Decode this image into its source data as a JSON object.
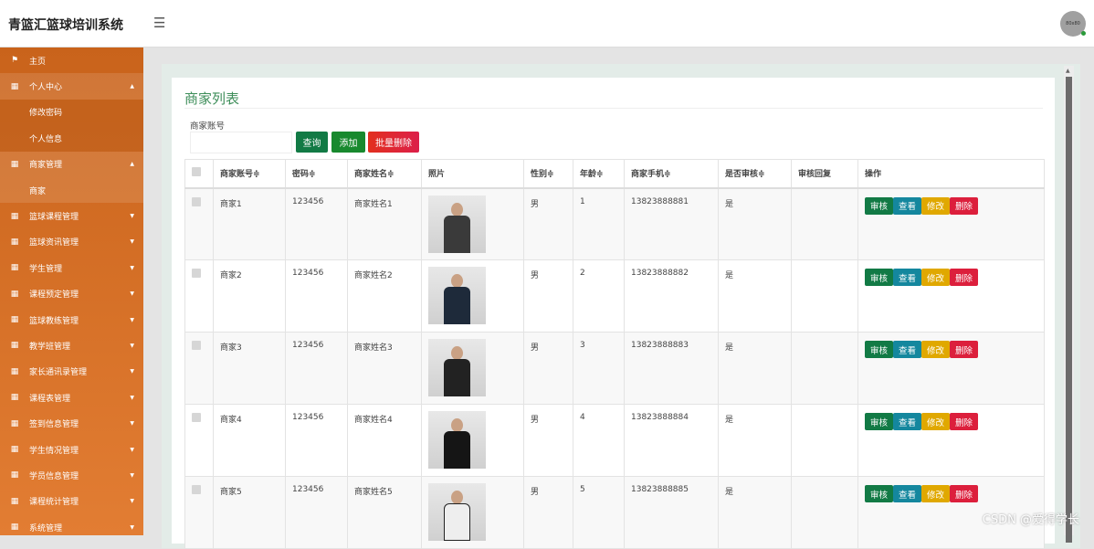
{
  "header": {
    "title": "青篮汇篮球培训系统",
    "avatar": "80x80"
  },
  "sidebar": [
    {
      "label": "主页",
      "icon": "flag-icon",
      "type": "top"
    },
    {
      "label": "个人中心",
      "icon": "grid-icon",
      "type": "open"
    },
    {
      "label": "修改密码",
      "type": "sub"
    },
    {
      "label": "个人信息",
      "type": "sub"
    },
    {
      "label": "商家管理",
      "icon": "grid-icon",
      "type": "open"
    },
    {
      "label": "商家",
      "type": "subactive"
    },
    {
      "label": "篮球课程管理",
      "icon": "grid-icon"
    },
    {
      "label": "篮球资讯管理",
      "icon": "grid-icon"
    },
    {
      "label": "学生管理",
      "icon": "grid-icon"
    },
    {
      "label": "课程预定管理",
      "icon": "grid-icon"
    },
    {
      "label": "篮球教练管理",
      "icon": "grid-icon"
    },
    {
      "label": "教学班管理",
      "icon": "grid-icon"
    },
    {
      "label": "家长通讯录管理",
      "icon": "grid-icon"
    },
    {
      "label": "课程表管理",
      "icon": "grid-icon"
    },
    {
      "label": "签到信息管理",
      "icon": "grid-icon"
    },
    {
      "label": "学生情况管理",
      "icon": "grid-icon"
    },
    {
      "label": "学员信息管理",
      "icon": "grid-icon"
    },
    {
      "label": "课程统计管理",
      "icon": "grid-icon"
    },
    {
      "label": "系统管理",
      "icon": "grid-icon"
    }
  ],
  "main": {
    "title": "商家列表",
    "filter_label": "商家账号",
    "filter_value": "",
    "buttons": {
      "search": "查询",
      "add": "添加",
      "batch_delete": "批量删除"
    },
    "columns": [
      "商家账号≑",
      "密码≑",
      "商家姓名≑",
      "照片",
      "性别≑",
      "年龄≑",
      "商家手机≑",
      "是否审核≑",
      "审核回复",
      "操作"
    ],
    "rows": [
      {
        "account": "商家1",
        "password": "123456",
        "name": "商家姓名1",
        "gender": "男",
        "age": "1",
        "phone": "13823888881",
        "audited": "是",
        "reply": ""
      },
      {
        "account": "商家2",
        "password": "123456",
        "name": "商家姓名2",
        "gender": "男",
        "age": "2",
        "phone": "13823888882",
        "audited": "是",
        "reply": ""
      },
      {
        "account": "商家3",
        "password": "123456",
        "name": "商家姓名3",
        "gender": "男",
        "age": "3",
        "phone": "13823888883",
        "audited": "是",
        "reply": ""
      },
      {
        "account": "商家4",
        "password": "123456",
        "name": "商家姓名4",
        "gender": "男",
        "age": "4",
        "phone": "13823888884",
        "audited": "是",
        "reply": ""
      },
      {
        "account": "商家5",
        "password": "123456",
        "name": "商家姓名5",
        "gender": "男",
        "age": "5",
        "phone": "13823888885",
        "audited": "是",
        "reply": ""
      }
    ],
    "row_actions": [
      "审核",
      "查看",
      "修改",
      "删除"
    ]
  },
  "colors": {
    "accent": "#3e8e5a",
    "audit": "#127a45",
    "view": "#14879e",
    "edit": "#e0a800",
    "delete": "#dc1f3c",
    "add": "#18892e",
    "sidebar": "#d5701f"
  },
  "watermark": "CSDN @爱得学长"
}
